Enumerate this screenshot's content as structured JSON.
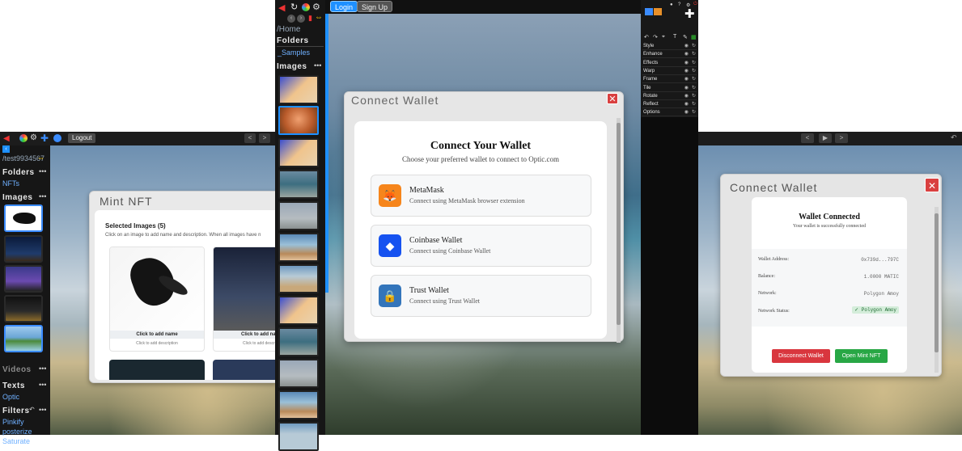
{
  "panel_left": {
    "topbar": {
      "logout_label": "Logout"
    },
    "sidebar": {
      "path": "/test9934567",
      "folders_label": "Folders",
      "folders": [
        "NFTs"
      ],
      "images_label": "Images",
      "videos_label": "Videos",
      "texts_label": "Texts",
      "texts": [
        "Optic"
      ],
      "filters_label": "Filters",
      "filters": [
        "Pinkify",
        "posterize",
        "Saturate"
      ]
    },
    "mint_modal": {
      "title": "Mint NFT",
      "selected_heading": "Selected Images (5)",
      "instructions": "Click on an image to add name and description. When all images have n",
      "card1": {
        "name_prompt": "Click to add name",
        "desc_prompt": "Click to add description"
      },
      "card2": {
        "name_prompt": "Click to add name",
        "desc_prompt": "Click to add descr"
      }
    }
  },
  "panel_middle": {
    "topbar": {
      "login_label": "Login",
      "signup_label": "Sign Up"
    },
    "sidebar": {
      "path": "/Home",
      "folders_label": "Folders",
      "folders": [
        "_Samples"
      ],
      "images_label": "Images"
    },
    "connect_modal": {
      "header": "Connect Wallet",
      "heading": "Connect Your Wallet",
      "subheading": "Choose your preferred wallet to connect to Optic.com",
      "wallets": [
        {
          "name": "MetaMask",
          "desc": "Connect using MetaMask browser extension",
          "icon": "fox-icon",
          "color": "#f6851b"
        },
        {
          "name": "Coinbase Wallet",
          "desc": "Connect using Coinbase Wallet",
          "icon": "coinbase-icon",
          "color": "#1652f0"
        },
        {
          "name": "Trust Wallet",
          "desc": "Connect using Trust Wallet",
          "icon": "lock-icon",
          "color": "#3375bb"
        }
      ]
    }
  },
  "panel_tools": {
    "menu": [
      "Style",
      "Enhance",
      "Effects",
      "Warp",
      "Frame",
      "Tile",
      "Rotate",
      "Reflect",
      "Options"
    ]
  },
  "panel_right": {
    "connected_modal": {
      "header": "Connect Wallet",
      "heading": "Wallet Connected",
      "subheading": "Your wallet is successfully connected",
      "rows": [
        {
          "label": "Wallet Address:",
          "value": "0x739d...797C"
        },
        {
          "label": "Balance:",
          "value": "1.0000 MATIC"
        },
        {
          "label": "Network:",
          "value": "Polygon Amoy"
        },
        {
          "label": "Network Status:",
          "value": "✓ Polygon Amoy"
        }
      ],
      "disconnect_label": "Disconnect Wallet",
      "open_mint_label": "Open Mint NFT"
    }
  },
  "colors": {
    "accent_blue": "#1e90ff",
    "danger_red": "#d9363e",
    "success_green": "#28a745",
    "link_blue": "#6fb0ff"
  }
}
